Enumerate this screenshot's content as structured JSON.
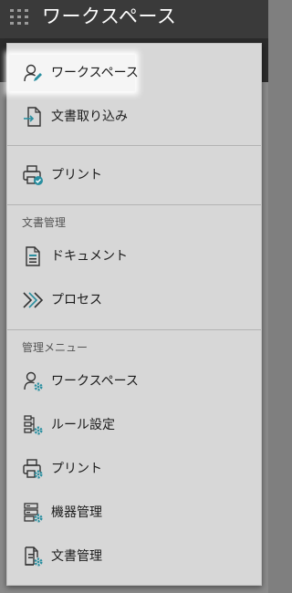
{
  "header": {
    "title": "ワークスペース"
  },
  "menu": {
    "top_items": [
      {
        "label": "ワークスペース",
        "icon": "user-edit-icon",
        "selected": true
      },
      {
        "label": "文書取り込み",
        "icon": "document-import-icon"
      }
    ],
    "print_item": {
      "label": "プリント",
      "icon": "printer-check-icon"
    },
    "document_management": {
      "header": "文書管理",
      "items": [
        {
          "label": "ドキュメント",
          "icon": "document-icon"
        },
        {
          "label": "プロセス",
          "icon": "process-chevrons-icon"
        }
      ]
    },
    "admin_menu": {
      "header": "管理メニュー",
      "items": [
        {
          "label": "ワークスペース",
          "icon": "user-settings-icon"
        },
        {
          "label": "ルール設定",
          "icon": "rules-settings-icon"
        },
        {
          "label": "プリント",
          "icon": "printer-settings-icon"
        },
        {
          "label": "機器管理",
          "icon": "device-settings-icon"
        },
        {
          "label": "文書管理",
          "icon": "document-settings-icon"
        }
      ]
    }
  },
  "colors": {
    "accent_teal": "#2a8fa0",
    "icon_dark": "#333333"
  }
}
